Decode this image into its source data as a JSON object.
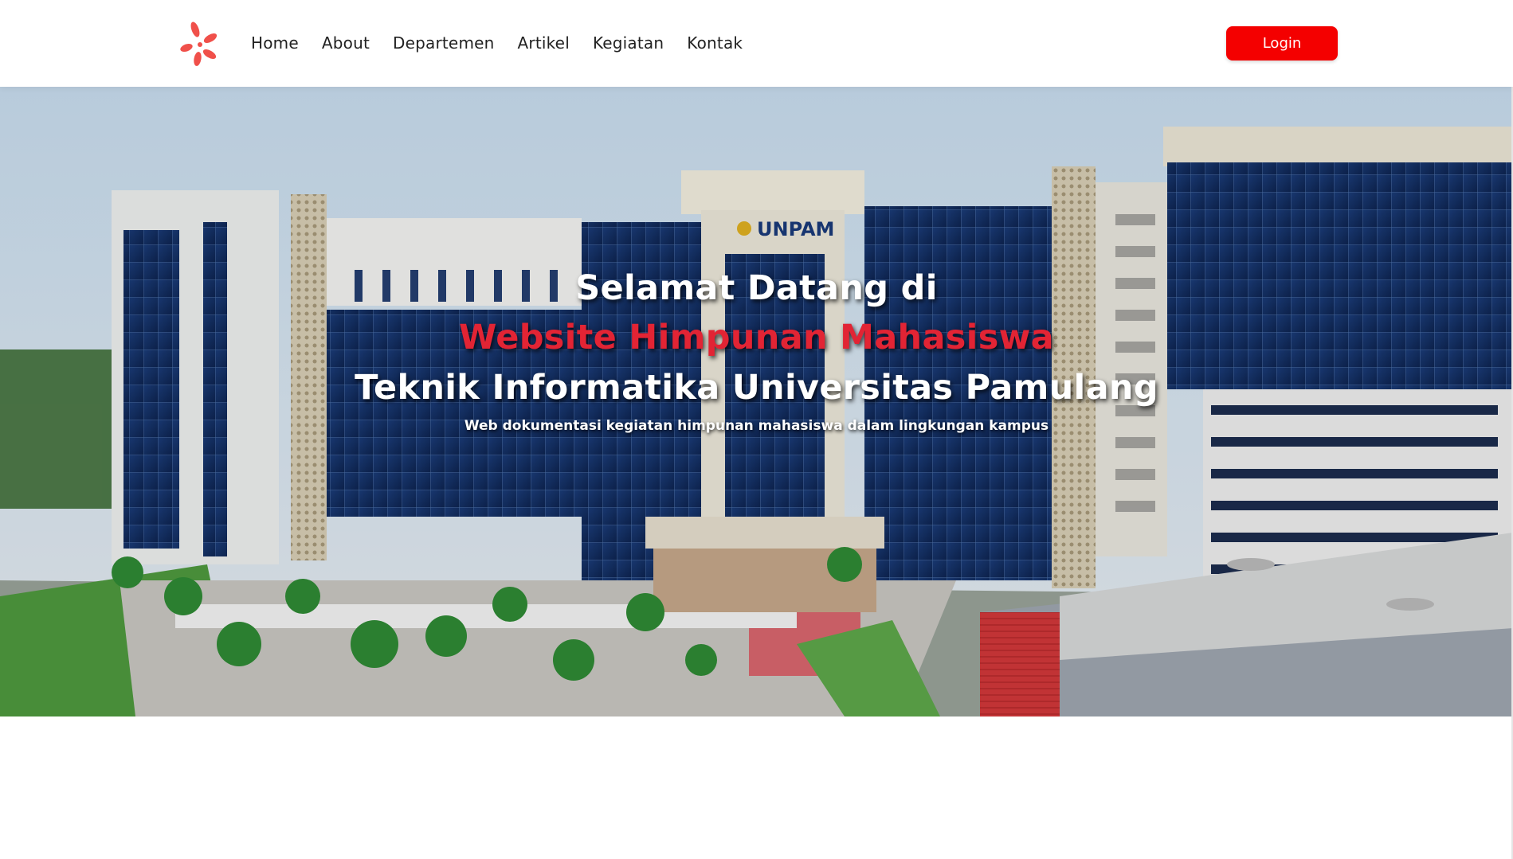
{
  "nav": {
    "logo_icon": "flower-logo-icon",
    "links": [
      "Home",
      "About",
      "Departemen",
      "Artikel",
      "Kegiatan",
      "Kontak"
    ],
    "login_label": "Login",
    "accent_color": "#f40000"
  },
  "hero": {
    "line1": "Selamat Datang di",
    "line2": "Website Himpunan Mahasiswa",
    "line3": "Teknik Informatika Universitas Pamulang",
    "subtitle": "Web dokumentasi kegiatan himpunan mahasiswa dalam lingkungan kampus",
    "building_sign": "UNPAM",
    "highlight_color": "#e22434"
  }
}
